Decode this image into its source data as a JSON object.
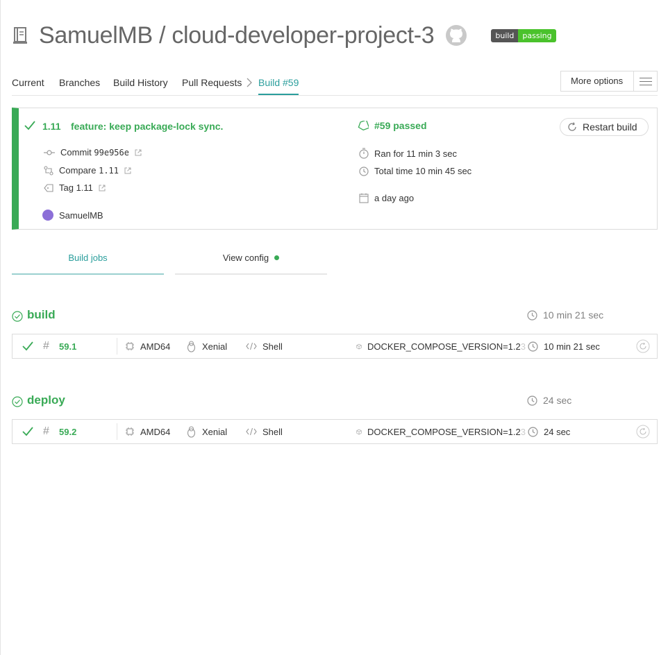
{
  "header": {
    "repo_title": "SamuelMB / cloud-developer-project-3",
    "badge_left": "build",
    "badge_right": "passing"
  },
  "tabs": {
    "current": "Current",
    "branches": "Branches",
    "history": "Build History",
    "pulls": "Pull Requests",
    "build": "Build #59",
    "more_options": "More options"
  },
  "summary": {
    "version": "1.11",
    "message": "feature: keep package-lock sync.",
    "commit_label": "Commit",
    "commit_sha": "99e956e",
    "compare_label": "Compare",
    "compare_ref": "1.11",
    "tag_label": "Tag 1.11",
    "author": "SamuelMB",
    "build_status": "#59 passed",
    "ran_for": "Ran for 11 min 3 sec",
    "total_time": "Total time 10 min 45 sec",
    "when": "a day ago",
    "restart": "Restart build"
  },
  "subtabs": {
    "jobs": "Build jobs",
    "config": "View config"
  },
  "stages": [
    {
      "name": "build",
      "duration": "10 min 21 sec",
      "job": {
        "number": "59.1",
        "arch": "AMD64",
        "os": "Xenial",
        "language": "Shell",
        "env": "DOCKER_COMPOSE_VERSION=1.2",
        "env_fade": "3",
        "duration": "10 min 21 sec"
      }
    },
    {
      "name": "deploy",
      "duration": "24 sec",
      "job": {
        "number": "59.2",
        "arch": "AMD64",
        "os": "Xenial",
        "language": "Shell",
        "env": "DOCKER_COMPOSE_VERSION=1.2",
        "env_fade": "3",
        "duration": "24 sec"
      }
    }
  ],
  "colors": {
    "passed": "#39aa56",
    "accent": "#2a9e9c"
  }
}
